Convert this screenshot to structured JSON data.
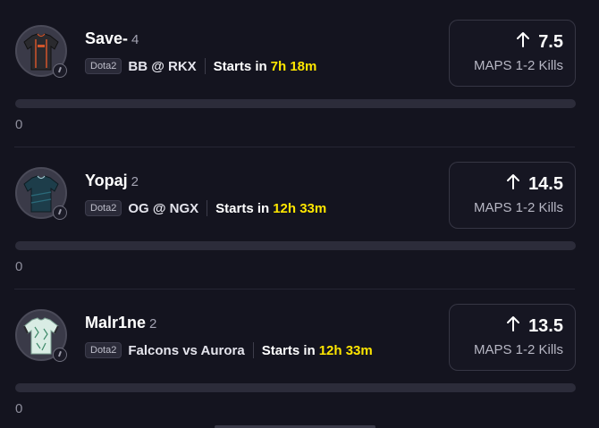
{
  "projections": [
    {
      "player": "Save-",
      "count": "4",
      "game_tag": "Dota2",
      "match": "BB @ RKX",
      "starts_label": "Starts in",
      "starts_time": "7h 18m",
      "line_value": "7.5",
      "direction_icon": "arrow-up-icon",
      "stat": "MAPS 1-2 Kills",
      "progress_value": 0,
      "progress_label": "0",
      "avatar_icon": "jersey-black-orange-icon",
      "jersey_color": "#2a2a2e",
      "jersey_accent": "#d2552a"
    },
    {
      "player": "Yopaj",
      "count": "2",
      "game_tag": "Dota2",
      "match": "OG @ NGX",
      "starts_label": "Starts in",
      "starts_time": "12h 33m",
      "line_value": "14.5",
      "direction_icon": "arrow-up-icon",
      "stat": "MAPS 1-2 Kills",
      "progress_value": 0,
      "progress_label": "0",
      "avatar_icon": "jersey-teal-icon",
      "jersey_color": "#1d3d4a",
      "jersey_accent": "#2b6a7a"
    },
    {
      "player": "Malr1ne",
      "count": "2",
      "game_tag": "Dota2",
      "match": "Falcons vs Aurora",
      "starts_label": "Starts in",
      "starts_time": "12h 33m",
      "line_value": "13.5",
      "direction_icon": "arrow-up-icon",
      "stat": "MAPS 1-2 Kills",
      "progress_value": 0,
      "progress_label": "0",
      "avatar_icon": "jersey-white-green-icon",
      "jersey_color": "#d9ece4",
      "jersey_accent": "#3f8a6a"
    }
  ],
  "colors": {
    "background": "#14141f",
    "highlight_time": "#ffe600",
    "bar_track": "#2c2c3a"
  }
}
